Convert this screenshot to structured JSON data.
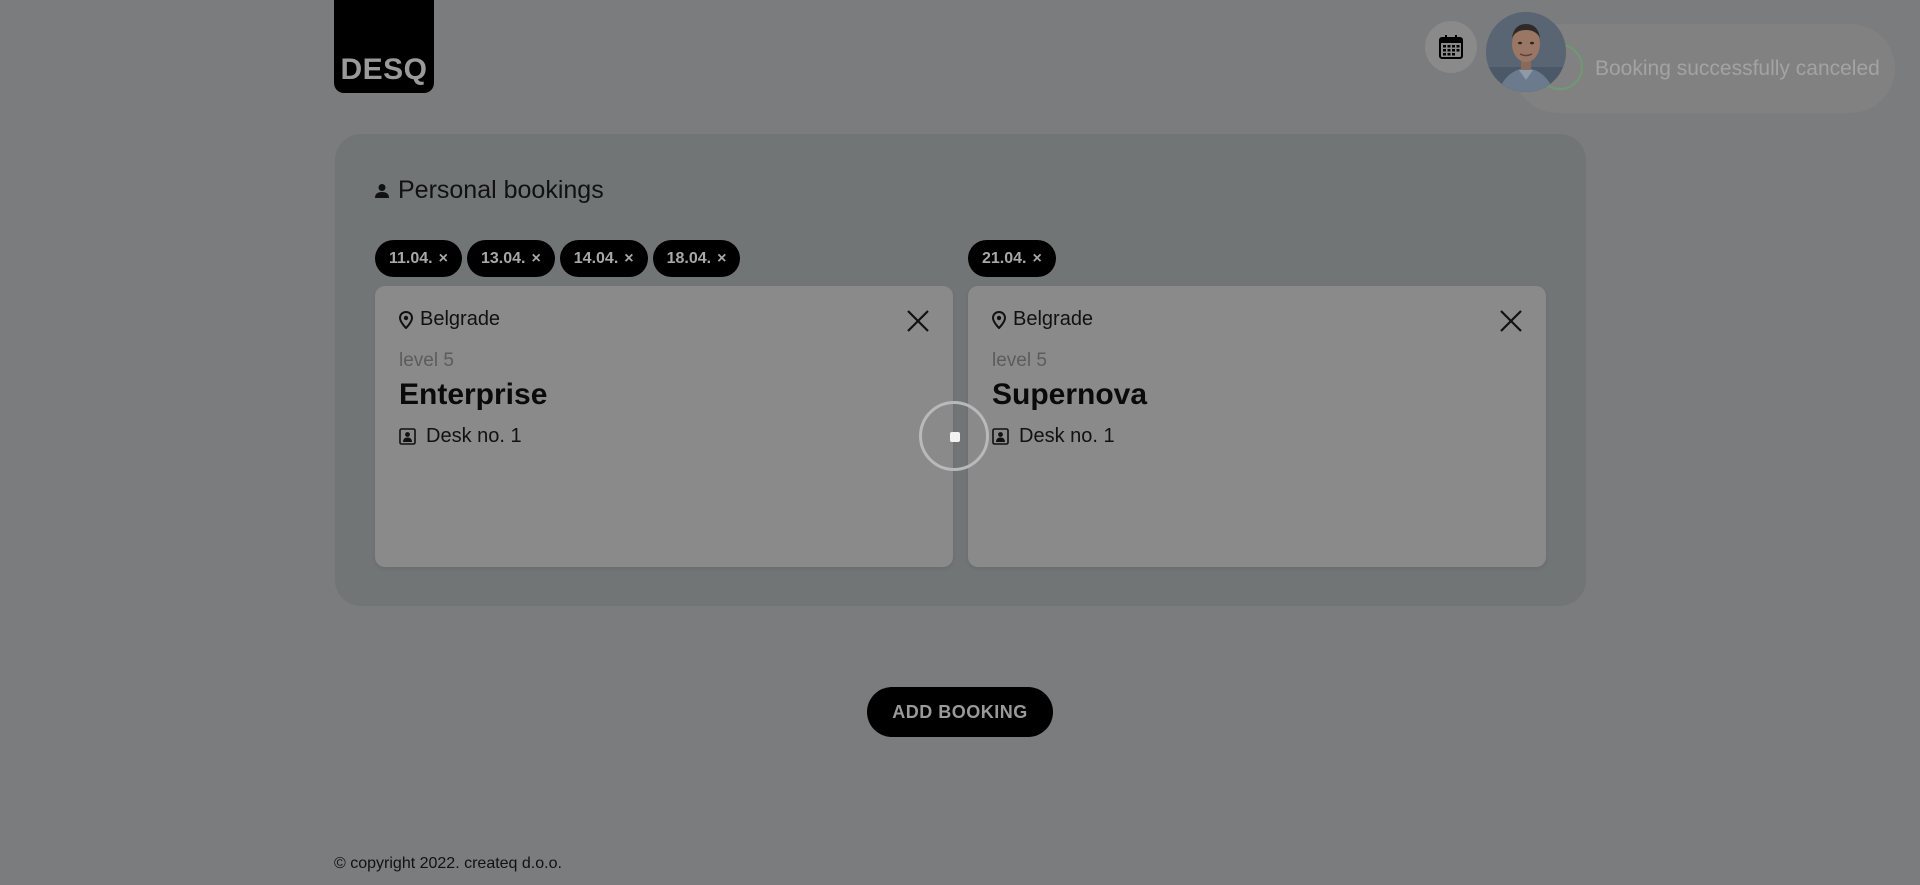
{
  "app": {
    "logo_text": "DESQ"
  },
  "header": {
    "calendar_icon": "calendar-icon",
    "avatar_icon": "user-avatar"
  },
  "toast": {
    "message": "Booking successfully canceled",
    "icon": "check-circle-icon"
  },
  "panel": {
    "title": "Personal bookings",
    "title_icon": "person-icon"
  },
  "bookings": [
    {
      "dates": [
        {
          "label": "11.04.",
          "remove": "×"
        },
        {
          "label": "13.04.",
          "remove": "×"
        },
        {
          "label": "14.04.",
          "remove": "×"
        },
        {
          "label": "18.04.",
          "remove": "×"
        }
      ],
      "location": "Belgrade",
      "level": "level 5",
      "room": "Enterprise",
      "desk": "Desk no. 1"
    },
    {
      "dates": [
        {
          "label": "21.04.",
          "remove": "×"
        }
      ],
      "location": "Belgrade",
      "level": "level 5",
      "room": "Supernova",
      "desk": "Desk no. 1"
    }
  ],
  "actions": {
    "add_booking_label": "ADD BOOKING"
  },
  "footer": {
    "copyright": "© copyright 2022. createq d.o.o."
  },
  "colors": {
    "overlay_background": "#7b7c7d",
    "panel": "#727576",
    "card": "#8a8a8a",
    "chip": "#000000",
    "toast_check": "#6e9a72"
  }
}
